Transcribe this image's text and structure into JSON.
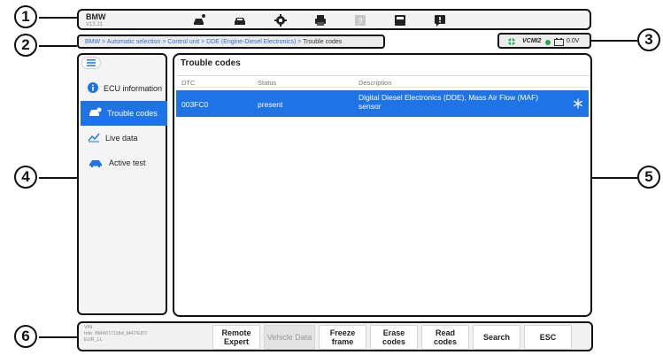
{
  "app": {
    "title": "BMW",
    "version": "V13.21"
  },
  "toolbar": {
    "icons": [
      "home-car-icon",
      "vehicle-icon",
      "settings-icon",
      "print-icon",
      "help-icon",
      "save-icon",
      "feedback-icon"
    ]
  },
  "breadcrumb": {
    "path": "BMW > Automatic selection > Control unit > DDE (Engine-Diesel Electronics) > ",
    "current": "Trouble codes"
  },
  "status": {
    "vci": "VCMI2",
    "voltage": "0.0V"
  },
  "sidebar": {
    "items": [
      {
        "label": "ECU information",
        "icon": "info-icon",
        "active": false
      },
      {
        "label": "Trouble codes",
        "icon": "trouble-codes-icon",
        "active": true
      },
      {
        "label": "Live data",
        "icon": "live-data-icon",
        "active": false
      },
      {
        "label": "Active test",
        "icon": "active-test-icon",
        "active": false
      }
    ]
  },
  "main": {
    "title": "Trouble codes",
    "columns": [
      "DTC",
      "Status",
      "Description"
    ],
    "rows": [
      {
        "dtc": "003FC0",
        "status": "present",
        "description_line1": "Digital Diesel Electronics (DDE), Mass Air Flow (MAF)",
        "description_line2": "sensor"
      }
    ]
  },
  "footer": {
    "vin_label": "VIN",
    "info": "Info: BMW/1'/118d_M47/E87/",
    "info2": "EUR_LL",
    "buttons": [
      {
        "line1": "Remote",
        "line2": "Expert",
        "enabled": true
      },
      {
        "line1": "Vehicle Data",
        "line2": "",
        "enabled": false
      },
      {
        "line1": "Freeze",
        "line2": "frame",
        "enabled": true
      },
      {
        "line1": "Erase",
        "line2": "codes",
        "enabled": true
      },
      {
        "line1": "Read",
        "line2": "codes",
        "enabled": true
      },
      {
        "line1": "Search",
        "line2": "",
        "enabled": true
      },
      {
        "line1": "ESC",
        "line2": "",
        "enabled": true
      }
    ]
  },
  "callouts": [
    "1",
    "2",
    "3",
    "4",
    "5",
    "6"
  ],
  "colors": {
    "accent": "#1e73e6",
    "link": "#2a6fd1",
    "vci_green": "#2aa84a"
  }
}
